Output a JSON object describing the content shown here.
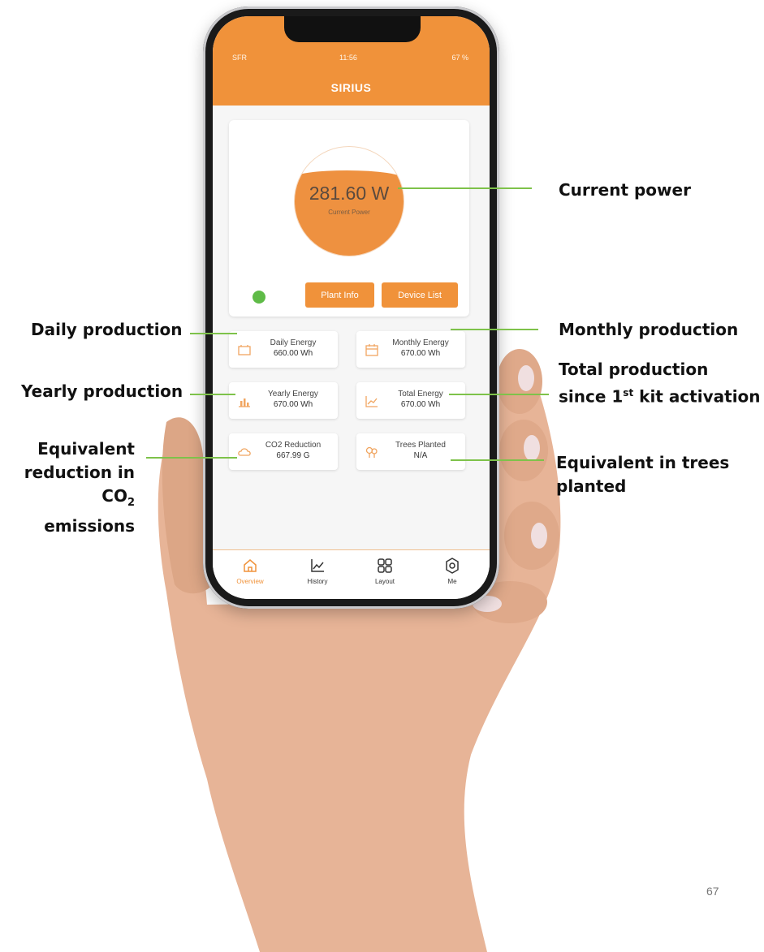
{
  "phone": {
    "status_bar": {
      "carrier": "SFR",
      "time": "11:56",
      "battery": "67 %"
    },
    "app_title": "SIRIUS",
    "current_power": {
      "value": "281.60 W",
      "label": "Current Power",
      "fill_fraction": 0.78
    },
    "status_indicator_color": "#5fbb47",
    "buttons": {
      "plant_info": "Plant Info",
      "device_list": "Device List"
    },
    "tiles": [
      {
        "label": "Daily Energy",
        "value": "660.00 Wh",
        "icon": "battery-icon"
      },
      {
        "label": "Monthly Energy",
        "value": "670.00 Wh",
        "icon": "calendar-icon"
      },
      {
        "label": "Yearly Energy",
        "value": "670.00 Wh",
        "icon": "bar-chart-icon"
      },
      {
        "label": "Total Energy",
        "value": "670.00 Wh",
        "icon": "line-chart-icon"
      },
      {
        "label": "CO2 Reduction",
        "value": "667.99 G",
        "icon": "cloud-icon"
      },
      {
        "label": "Trees Planted",
        "value": "N/A",
        "icon": "trees-icon"
      }
    ],
    "tabs": [
      {
        "label": "Overview",
        "icon": "home-icon",
        "active": true
      },
      {
        "label": "History",
        "icon": "chart-icon",
        "active": false
      },
      {
        "label": "Layout",
        "icon": "grid-icon",
        "active": false
      },
      {
        "label": "Me",
        "icon": "settings-icon",
        "active": false
      }
    ],
    "accent_color": "#f0923a"
  },
  "annotations": {
    "current_power": "Current power",
    "daily": "Daily production",
    "monthly": "Monthly production",
    "yearly": "Yearly production",
    "total_line1": "Total production",
    "total_line2_a": "since 1",
    "total_line2_sup": "st",
    "total_line2_b": " kit activation",
    "co2_line1": "Equivalent",
    "co2_line2": "reduction in",
    "co2_line3_a": "CO",
    "co2_line3_sub": "2",
    "co2_line3_b": " emissions",
    "trees_line1": "Equivalent in trees",
    "trees_line2": "planted",
    "leader_color": "#7ec24a"
  },
  "page_number": "67"
}
